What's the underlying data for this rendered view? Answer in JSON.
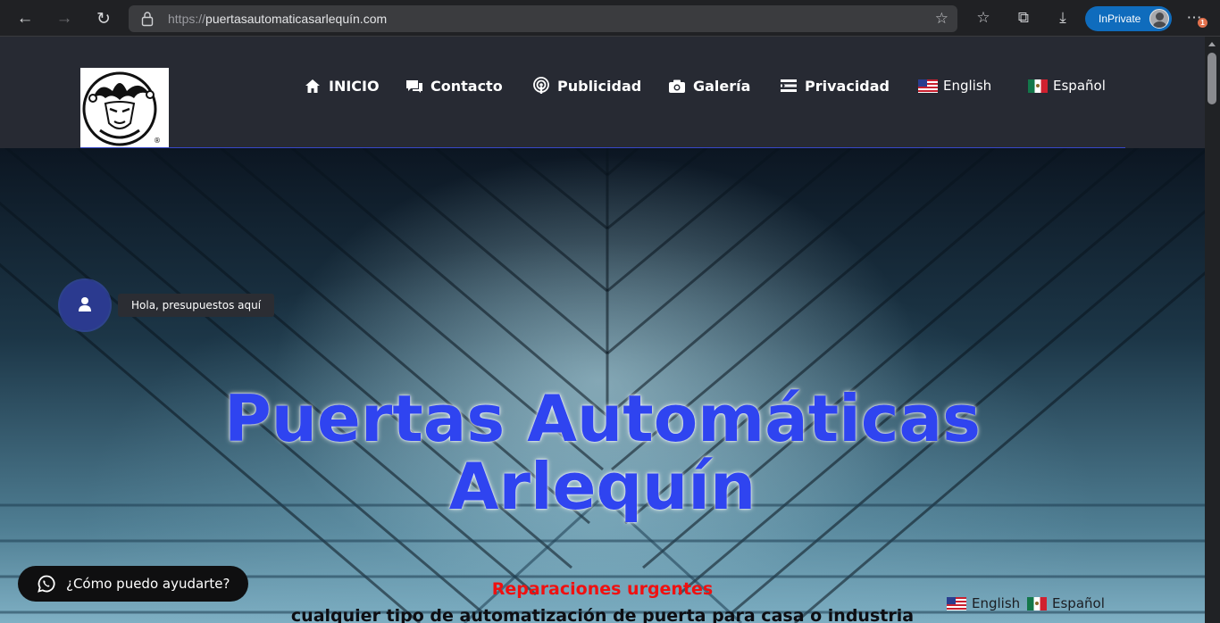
{
  "browser": {
    "url_scheme": "https://",
    "url_host": "puertasautomaticasarlequín.com",
    "inprivate_label": "InPrivate",
    "notification_count": "1"
  },
  "site": {
    "nav": [
      {
        "label": "INICIO",
        "icon": "home-icon"
      },
      {
        "label": "Contacto",
        "icon": "chat-icon"
      },
      {
        "label": "Publicidad",
        "icon": "podcast-icon"
      },
      {
        "label": "Galería",
        "icon": "camera-icon"
      },
      {
        "label": "Privacidad",
        "icon": "list-icon"
      }
    ],
    "lang_nav": {
      "english": "English",
      "spanish": "Español"
    },
    "accent_color": "#2f44f0"
  },
  "hero": {
    "title_line1": "Puertas Automáticas",
    "title_line2": "Arlequín",
    "subtitle": "Reparaciones urgentes",
    "description": "cualquier tipo de automatización de puerta para casa o industria"
  },
  "widgets": {
    "chat_tooltip": "Hola, presupuestos aquí",
    "whatsapp_label": "¿Cómo puedo ayudarte?",
    "lang_switch": {
      "english": "English",
      "spanish": "Español"
    }
  }
}
